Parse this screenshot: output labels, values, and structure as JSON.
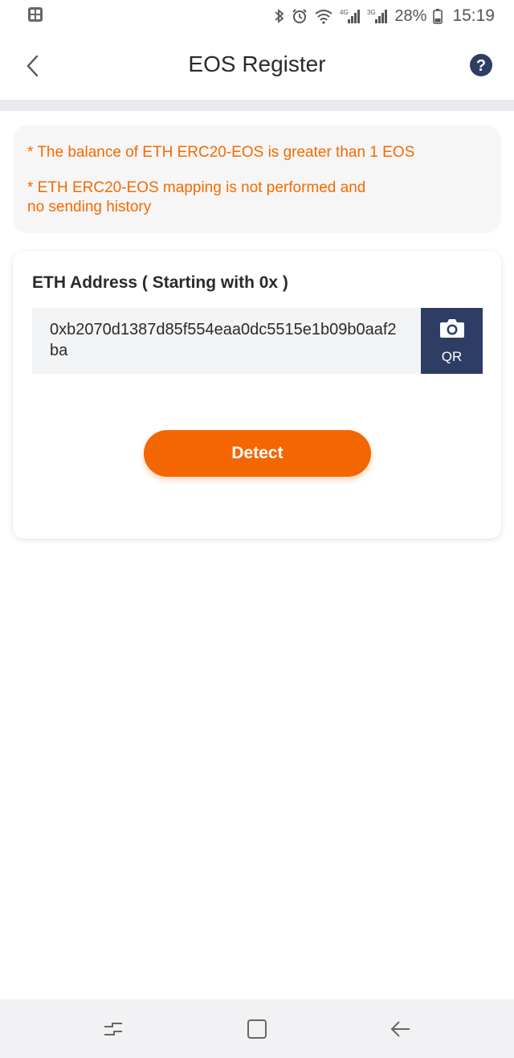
{
  "status_bar": {
    "icons": [
      "gallery-icon",
      "bluetooth-icon",
      "alarm-icon",
      "wifi-icon",
      "signal-4g-icon",
      "signal-3g-icon",
      "battery-icon"
    ],
    "battery": "28%",
    "time": "15:19"
  },
  "header": {
    "title": "EOS Register",
    "back_icon": "chevron-left-icon",
    "help_icon": "question-icon",
    "accent": "#2e3d63"
  },
  "notice": {
    "line1": "* The balance of ETH ERC20-EOS is greater than 1 EOS",
    "line2": "* ETH ERC20-EOS mapping is not performed and\nno sending history",
    "color": "#f56a00"
  },
  "form": {
    "label": "ETH Address ( Starting with 0x )",
    "address": "0xb2070d1387d85f554eaa0dc5515e1b09b0aaf2ba",
    "qr_label": "QR",
    "qr_icon": "camera-icon",
    "detect_label": "Detect",
    "detect_color": "#f46602"
  },
  "nav_bar": {
    "icons": [
      "recent-apps-icon",
      "home-icon",
      "back-icon"
    ]
  }
}
